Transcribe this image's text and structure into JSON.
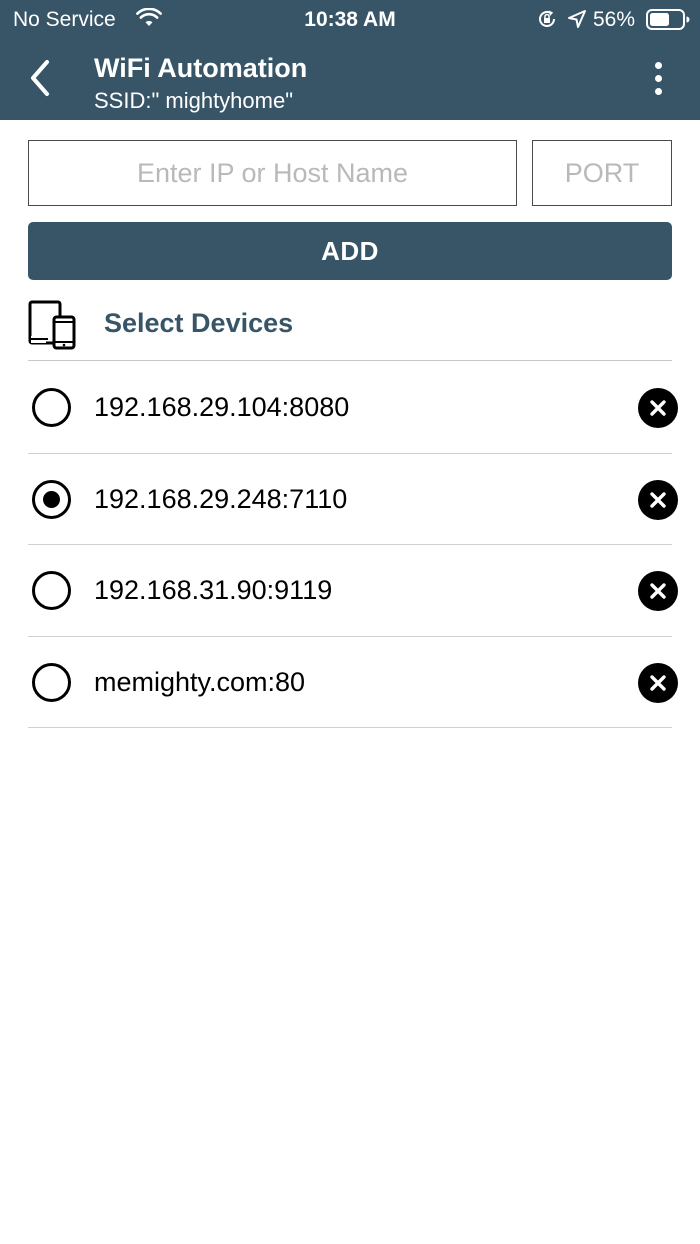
{
  "status_bar": {
    "carrier": "No Service",
    "time": "10:38 AM",
    "battery_percent": "56%",
    "icons": [
      "wifi-icon",
      "rotation-lock-icon",
      "location-arrow-icon",
      "battery-icon"
    ]
  },
  "nav": {
    "title": "WiFi Automation",
    "subtitle": "SSID:\" mightyhome\"",
    "back_icon": "chevron-left-icon",
    "menu_icon": "more-vertical-icon"
  },
  "form": {
    "host_placeholder": "Enter IP or Host Name",
    "host_value": "",
    "port_placeholder": "PORT",
    "port_value": "",
    "add_label": "ADD"
  },
  "section": {
    "title": "Select Devices",
    "icon": "devices-icon"
  },
  "devices": [
    {
      "label": "192.168.29.104:8080",
      "selected": false
    },
    {
      "label": "192.168.29.248:7110",
      "selected": true
    },
    {
      "label": "192.168.31.90:9119",
      "selected": false
    },
    {
      "label": "memighty.com:80",
      "selected": false
    }
  ],
  "colors": {
    "primary": "#375567",
    "background": "#ffffff",
    "text": "#000000",
    "placeholder": "#b9b9b9",
    "divider": "#c8c8c8"
  }
}
